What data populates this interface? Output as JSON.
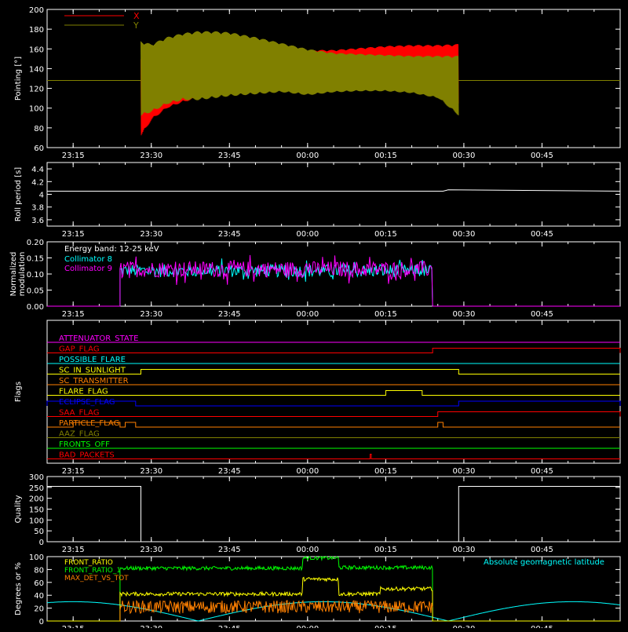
{
  "chart_data": [
    {
      "type": "line",
      "ylabel": "Pointing [°]",
      "ylim": [
        60,
        200
      ],
      "yticks": [
        60,
        80,
        100,
        120,
        140,
        160,
        180,
        200
      ],
      "xticks": [
        "23:15",
        "23:30",
        "23:45",
        "00:00",
        "00:15",
        "00:30",
        "00:45"
      ],
      "xlim_minutes": [
        -50,
        60
      ],
      "legend": [
        {
          "name": "X",
          "color": "#ff0000"
        },
        {
          "name": "Y",
          "color": "#808000"
        }
      ],
      "baseline": 128,
      "active_window": [
        "23:28",
        "00:29"
      ],
      "series": [
        {
          "name": "X",
          "color": "#ff0000",
          "x": [
            "23:28",
            "23:30",
            "23:33",
            "23:36",
            "23:39",
            "23:42",
            "23:45",
            "23:50",
            "23:55",
            "00:00",
            "00:05",
            "00:10",
            "00:15",
            "00:20",
            "00:25",
            "00:29"
          ],
          "upper": [
            150,
            152,
            156,
            159,
            160,
            161,
            162,
            161,
            160,
            159,
            159,
            161,
            163,
            164,
            164,
            165
          ],
          "lower": [
            72,
            88,
            100,
            106,
            110,
            112,
            114,
            116,
            118,
            114,
            118,
            120,
            120,
            119,
            114,
            104
          ]
        },
        {
          "name": "Y",
          "color": "#808000",
          "x": [
            "23:28",
            "23:30",
            "23:33",
            "23:36",
            "23:39",
            "23:42",
            "23:45",
            "23:50",
            "23:55",
            "00:00",
            "00:05",
            "00:10",
            "00:15",
            "00:20",
            "00:25",
            "00:29"
          ],
          "upper": [
            168,
            165,
            172,
            176,
            178,
            178,
            177,
            172,
            166,
            160,
            156,
            155,
            154,
            153,
            153,
            153
          ],
          "lower": [
            92,
            96,
            104,
            108,
            108,
            110,
            112,
            114,
            116,
            113,
            116,
            117,
            117,
            115,
            110,
            92
          ]
        }
      ]
    },
    {
      "type": "line",
      "ylabel": "Roll period [s]",
      "ylim": [
        3.5,
        4.5
      ],
      "yticks": [
        3.6,
        3.8,
        4.0,
        4.2,
        4.4
      ],
      "xticks": [
        "23:15",
        "23:30",
        "23:45",
        "00:00",
        "00:15",
        "00:30",
        "00:45"
      ],
      "series": [
        {
          "name": "Roll period",
          "color": "#ffffff",
          "x": [
            "23:10",
            "00:26",
            "00:27",
            "01:50"
          ],
          "y": [
            4.05,
            4.05,
            4.07,
            4.05
          ]
        }
      ]
    },
    {
      "type": "line",
      "ylabel": "Normalized modulation",
      "ylim": [
        0,
        0.2
      ],
      "yticks": [
        "0.00",
        "0.05",
        "0.10",
        "0.15",
        "0.20"
      ],
      "xticks": [
        "23:15",
        "23:30",
        "23:45",
        "00:00",
        "00:15",
        "00:30",
        "00:45"
      ],
      "annotation": "Energy band: 12-25 keV",
      "legend": [
        {
          "name": "Collimator 8",
          "color": "#00ffff"
        },
        {
          "name": "Collimator 9",
          "color": "#ff00ff"
        }
      ],
      "active_window": [
        "23:24",
        "00:24"
      ],
      "series": [
        {
          "name": "Collimator 8",
          "color": "#00ffff",
          "mean": 0.11,
          "spread": 0.02
        },
        {
          "name": "Collimator 9",
          "color": "#ff00ff",
          "mean": 0.115,
          "spread": 0.025
        }
      ]
    },
    {
      "type": "step",
      "ylabel": "Flags",
      "xticks": [
        "23:15",
        "23:30",
        "23:45",
        "00:00",
        "00:15",
        "00:30",
        "00:45"
      ],
      "flags": [
        {
          "name": "ATTENUATOR_STATE",
          "color": "#ff00ff",
          "high": []
        },
        {
          "name": "GAP_FLAG",
          "color": "#ff0000",
          "high": [
            [
              "00:24",
              "02:00"
            ]
          ]
        },
        {
          "name": "POSSIBLE_FLARE",
          "color": "#00ffff",
          "high": []
        },
        {
          "name": "SC_IN_SUNLIGHT",
          "color": "#ffff00",
          "high": [
            [
              "23:28",
              "00:29"
            ]
          ],
          "default_high": false
        },
        {
          "name": "SC_TRANSMITTER",
          "color": "#ff8000",
          "high": []
        },
        {
          "name": "FLARE_FLAG",
          "color": "#ffff00",
          "high": [
            [
              "00:15",
              "00:22"
            ]
          ]
        },
        {
          "name": "ECLIPSE_FLAG",
          "color": "#0000ff",
          "high": [
            [
              "23:00",
              "23:27"
            ],
            [
              "00:29",
              "02:00"
            ]
          ]
        },
        {
          "name": "SAA_FLAG",
          "color": "#ff0000",
          "high": [
            [
              "00:25",
              "02:00"
            ]
          ]
        },
        {
          "name": "PARTICLE_FLAG",
          "color": "#ff8000",
          "high": [
            [
              "23:15",
              "23:24"
            ],
            [
              "23:25",
              "23:27"
            ],
            [
              "00:25",
              "00:26"
            ]
          ]
        },
        {
          "name": "AAZ_FLAG",
          "color": "#808000",
          "high": []
        },
        {
          "name": "FRONTS_OFF",
          "color": "#00ff00",
          "high": []
        },
        {
          "name": "BAD_PACKETS",
          "color": "#ff0000",
          "high": [
            [
              "00:12",
              "00:12"
            ]
          ]
        }
      ]
    },
    {
      "type": "line",
      "ylabel": "Quality",
      "ylim": [
        0,
        300
      ],
      "yticks": [
        0,
        50,
        100,
        150,
        200,
        250,
        300
      ],
      "xticks": [
        "23:15",
        "23:30",
        "23:45",
        "00:00",
        "00:15",
        "00:30",
        "00:45"
      ],
      "series": [
        {
          "name": "Quality",
          "color": "#ffffff",
          "x": [
            "23:10",
            "23:28",
            "23:28",
            "00:29",
            "00:29",
            "01:50"
          ],
          "y": [
            255,
            255,
            0,
            0,
            255,
            255
          ]
        }
      ]
    },
    {
      "type": "line",
      "ylabel": "Degrees or %",
      "ylim": [
        0,
        100
      ],
      "yticks": [
        0,
        20,
        40,
        60,
        80,
        100
      ],
      "xticks": [
        "23:15",
        "23:30",
        "23:45",
        "00:00",
        "00:15",
        "00:30",
        "00:45"
      ],
      "legend": [
        {
          "name": "FRONT_RATIO",
          "color": "#ffff00"
        },
        {
          "name": "FRONT_RATIO_1",
          "color": "#00ff00"
        },
        {
          "name": "MAX_DET_VS_TOT",
          "color": "#ff8000"
        },
        {
          "name": "Absolute geomagnetic latitude",
          "color": "#00ffff"
        }
      ],
      "active_window": [
        "23:24",
        "00:24"
      ],
      "series": [
        {
          "name": "FRONT_RATIO_1",
          "color": "#00ff00",
          "steps": [
            [
              "23:24",
              82
            ],
            [
              "23:59",
              98
            ],
            [
              "00:06",
              83
            ],
            [
              "00:24",
              83
            ]
          ]
        },
        {
          "name": "FRONT_RATIO",
          "color": "#ffff00",
          "steps": [
            [
              "23:24",
              42
            ],
            [
              "23:59",
              65
            ],
            [
              "00:06",
              42
            ],
            [
              "00:14",
              50
            ],
            [
              "00:24",
              50
            ]
          ]
        },
        {
          "name": "MAX_DET_VS_TOT",
          "color": "#ff8000",
          "mean": 22,
          "spread": 10
        },
        {
          "name": "Absolute geomagnetic latitude",
          "color": "#00ffff",
          "period_min": 48,
          "amplitude": 30
        }
      ]
    }
  ]
}
